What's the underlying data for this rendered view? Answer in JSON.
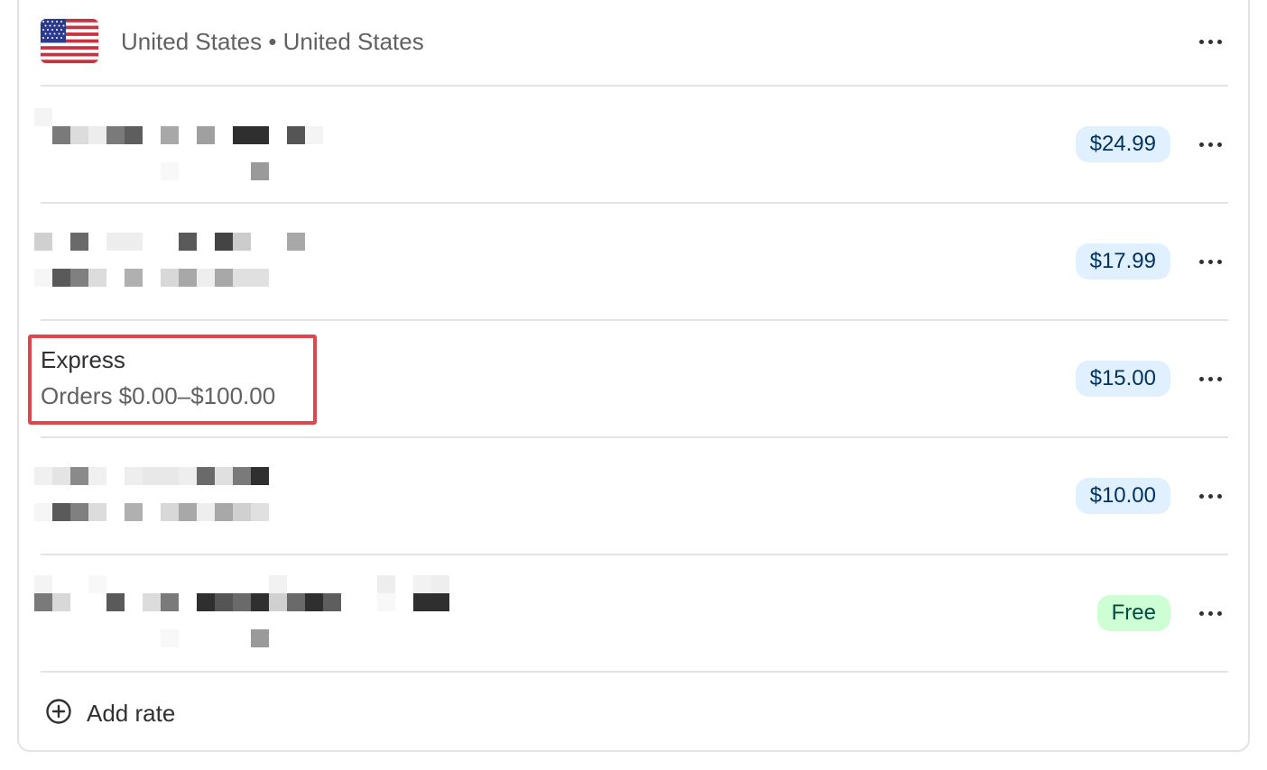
{
  "zone": {
    "flag_icon": "us-flag-icon",
    "title": "United States • United States",
    "menu_icon": "more-horizontal-icon"
  },
  "rates": [
    {
      "name": "",
      "condition": "",
      "price": "$24.99",
      "redacted": true
    },
    {
      "name": "",
      "condition": "",
      "price": "$17.99",
      "redacted": true
    },
    {
      "name": "Express",
      "condition": "Orders $0.00–$100.00",
      "price": "$15.00",
      "redacted": false,
      "highlighted": true
    },
    {
      "name": "",
      "condition": "",
      "price": "$10.00",
      "redacted": true
    },
    {
      "name": "",
      "condition": "",
      "price": "Free",
      "redacted": true
    }
  ],
  "add_rate": {
    "label": "Add rate",
    "icon": "plus-circle-icon"
  },
  "colors": {
    "price_badge_bg": "#e0f0ff",
    "price_badge_text": "#00325f",
    "free_badge_bg": "#cdfed4",
    "free_badge_text": "#014b40",
    "highlight": "#e0474c"
  }
}
